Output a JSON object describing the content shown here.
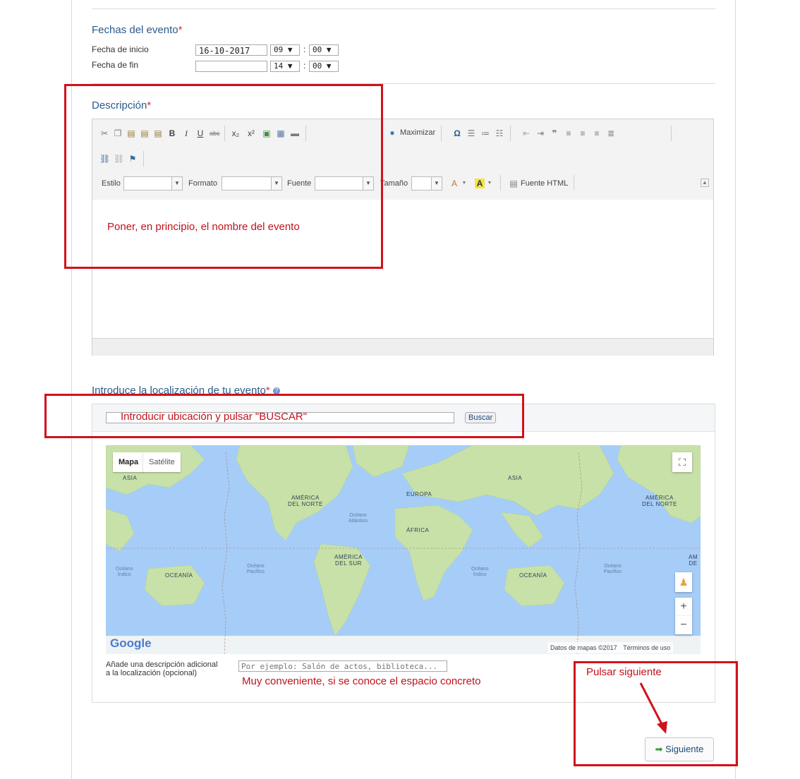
{
  "dates": {
    "title": "Fechas del evento",
    "required_mark": "*",
    "start_label": "Fecha de inicio",
    "end_label": "Fecha de fin",
    "start_date": "16-10-2017",
    "start_hour": "09 ▼",
    "start_minute": "00 ▼",
    "end_date": "",
    "end_hour": "14 ▼",
    "end_minute": "00 ▼",
    "colon": ":"
  },
  "description": {
    "title": "Descripción",
    "required_mark": "*",
    "toolbar": {
      "maximize": "Maximizar",
      "style_label": "Estilo",
      "format_label": "Formato",
      "font_label": "Fuente",
      "size_label": "Tamaño",
      "html_source": "Fuente HTML",
      "icons": [
        "cut-icon",
        "copy-icon",
        "paste-icon",
        "paste-text-icon",
        "paste-word-icon",
        "bold-icon",
        "italic-icon",
        "underline-icon",
        "strike-icon",
        "subscript-icon",
        "superscript-icon",
        "image-icon",
        "table-icon",
        "hr-icon",
        "globe-icon",
        "omega-icon",
        "special-icon",
        "ordered-list-icon",
        "bullet-list-icon",
        "outdent-icon",
        "indent-icon",
        "blockquote-icon",
        "align-left-icon",
        "align-center-icon",
        "align-right-icon",
        "justify-icon",
        "link-icon",
        "unlink-icon",
        "anchor-icon"
      ]
    },
    "annotation": "Poner, en principio, el nombre del evento"
  },
  "location": {
    "title": "Introduce la localización de tu evento",
    "required_mark": "*",
    "search_annotation": "Introducir ubicación y pulsar \"BUSCAR\"",
    "search_button": "Buscar",
    "map_tab_map": "Mapa",
    "map_tab_satellite": "Satélite",
    "map_labels": {
      "asia_left": "ASIA",
      "asia_right": "ASIA",
      "na_left": "AMÉRICA\nDEL NORTE",
      "na_right": "AMÉRICA\nDEL NORTE",
      "europe": "EUROPA",
      "africa": "ÁFRICA",
      "sa": "AMÉRICA\nDEL SUR",
      "am_right": "AM\nDE",
      "oceania_left": "OCEANÍA",
      "oceania_right": "OCEANÍA",
      "ocean_indian_left": "Océano\nÍndico",
      "ocean_pacific_left": "Océano\nPacífico",
      "ocean_atlantic": "Océano\nAtlántico",
      "ocean_indian_right": "Océano\nÍndico",
      "ocean_pacific_right": "Océano\nPacífico"
    },
    "google_logo": "Google",
    "map_data": "Datos de mapas ©2017",
    "map_terms": "Términos de uso",
    "zoom_in": "+",
    "zoom_out": "−",
    "extra_label_line1": "Añade una descripción adicional",
    "extra_label_line2": "a la localización (opcional)",
    "extra_placeholder": "Por ejemplo: Salón de actos, biblioteca...",
    "extra_annotation": "Muy conveniente, si se conoce el espacio concreto"
  },
  "footer": {
    "next_annotation": "Pulsar siguiente",
    "next_button": "Siguiente",
    "next_icon": "arrow-right-icon"
  },
  "colors": {
    "annotation_red": "#d0121b",
    "section_blue": "#2a5a8a",
    "map_water": "#a6cdf7",
    "map_land": "#c8e1a8"
  }
}
